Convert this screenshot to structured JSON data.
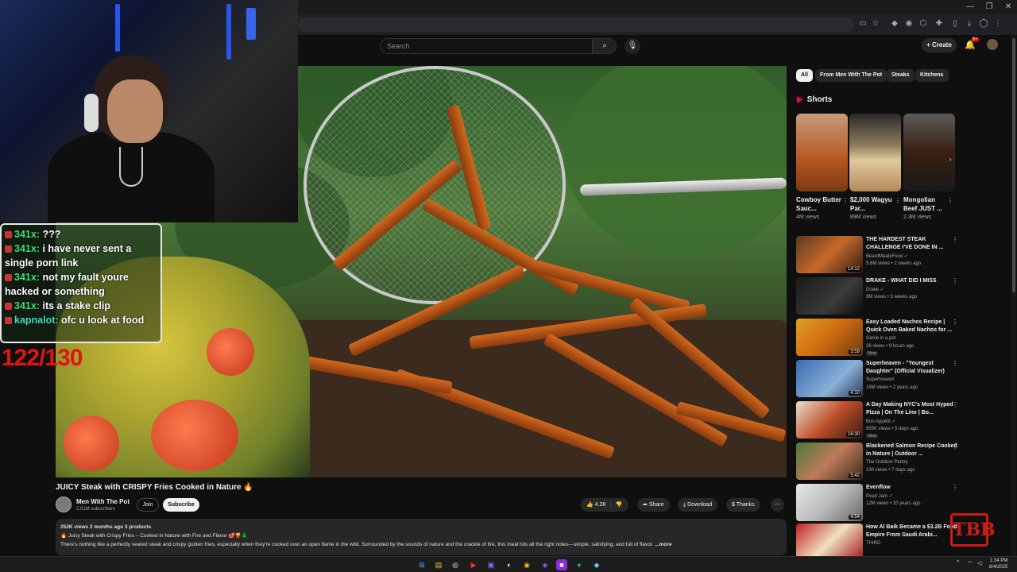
{
  "browser": {
    "min_icon": "—",
    "restore_icon": "❐",
    "close_icon": "✕"
  },
  "youtube": {
    "search_placeholder": "Search",
    "create_label": "+ Create",
    "notification_badge": "9+"
  },
  "video": {
    "title": "JUICY Steak with CRISPY Fries Cooked in Nature 🔥",
    "channel": "Men With The Pot",
    "subscribers": "2.01M subscribers",
    "join_label": "Join",
    "subscribe_label": "Subscribe",
    "likes": "4.2K",
    "share_label": "Share",
    "download_label": "Download",
    "thanks_label": "Thanks",
    "stats": "252K views  2 months ago  3 products",
    "desc_line1": "🔥 Juicy Steak with Crispy Fries – Cooked in Nature with Fire and Flavor 🥩🍟🌲",
    "desc_line2": "There's nothing like a perfectly seared steak and crispy golden fries, especially when they're cooked over an open flame in the wild. Surrounded by the sounds of nature and the crackle of fire, this meal hits all the right notes—simple, satisfying, and full of flavor.",
    "more_label": "...more"
  },
  "chips": [
    "All",
    "From Men With The Pot",
    "Steaks",
    "Kitchens"
  ],
  "shorts": {
    "heading": "Shorts",
    "items": [
      {
        "title": "Cowboy Butter Sauc...",
        "views": "4M views"
      },
      {
        "title": "$2,000 Wagyu Par...",
        "views": "89M views"
      },
      {
        "title": "Mongolian Beef JUST ...",
        "views": "2.3M views"
      }
    ]
  },
  "recommendations": [
    {
      "title": "THE HARDEST STEAK CHALLENGE I'VE DONE IN ...",
      "channel": "BeardMeatsFood ✓",
      "meta": "5.6M views • 2 weeks ago",
      "duration": "14:12",
      "badge": ""
    },
    {
      "title": "DRAKE - WHAT DID I MISS",
      "channel": "Drake ✓",
      "meta": "9M views • 3 weeks ago",
      "duration": "",
      "badge": ""
    },
    {
      "title": "Easy Loaded Nachos Recipe | Quick Oven Baked Nachos for ...",
      "channel": "Genie in a pot",
      "meta": "26 views • 9 hours ago",
      "duration": "3:59",
      "badge": "New"
    },
    {
      "title": "Superheaven - \"Youngest Daughter\" (Official Visualizer)",
      "channel": "Superheaven",
      "meta": "15M views • 2 years ago",
      "duration": "4:10",
      "badge": ""
    },
    {
      "title": "A Day Making NYC's Most Hyped Pizza | On The Line | Bo...",
      "channel": "Bon Appétit ✓",
      "meta": "955K views • 5 days ago",
      "duration": "16:30",
      "badge": "New"
    },
    {
      "title": "Blackened Salmon Recipe Cooked in Nature | Outdoor ...",
      "channel": "The Outdoor Pantry",
      "meta": "130 views • 7 days ago",
      "duration": "5:42",
      "badge": ""
    },
    {
      "title": "Evenflow",
      "channel": "Pearl Jam ✓",
      "meta": "12M views • 10 years ago",
      "duration": "4:54",
      "badge": ""
    },
    {
      "title": "How Al Baik Became a $3.2B Food Empire From Saudi Arabi...",
      "channel": "THIRD",
      "meta": "",
      "duration": "",
      "badge": ""
    }
  ],
  "chat": [
    {
      "user": "341x:",
      "msg": "???"
    },
    {
      "user": "341x:",
      "msg": "i have never sent a single porn link"
    },
    {
      "user": "341x:",
      "msg": "not my fault youre hacked or something"
    },
    {
      "user": "341x:",
      "msg": "its a stake clip"
    },
    {
      "user": "kapnalot:",
      "msg": "ofc u look at food"
    }
  ],
  "overlay": {
    "counter": "122/130",
    "stream_logo": "TBB"
  },
  "taskbar": {
    "time": "1:34 PM",
    "date": "8/4/2025"
  },
  "colors": {
    "chat_username": "#3fe07a",
    "counter_red": "#e01414",
    "yt_red": "#ff0033"
  }
}
